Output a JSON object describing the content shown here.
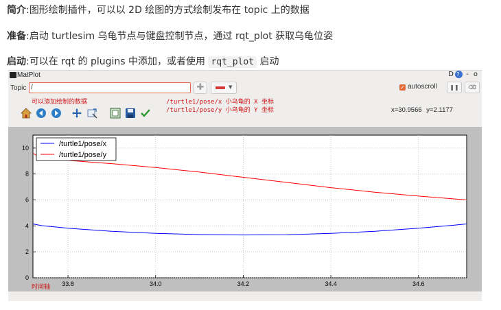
{
  "intro": {
    "line1_label": "简介",
    "line1_text": ":图形绘制插件，可以以 2D 绘图的方式绘制发布在 topic 上的数据",
    "line2_label": "准备",
    "line2_text": ":启动 turtlesim 乌龟节点与键盘控制节点，通过 rqt_plot 获取乌龟位姿",
    "line3_label": "启动",
    "line3_text_a": ":可以在 rqt 的 plugins 中添加，或者使用",
    "line3_code": "rqt_plot",
    "line3_text_b": "启动"
  },
  "window": {
    "title": "MatPlot",
    "controls": "D",
    "help": "?",
    "min": "-",
    "close": "o"
  },
  "topic": {
    "label": "Topic",
    "value": "/",
    "add_icon": "plus-icon",
    "remove_icon": "minus-icon"
  },
  "autoscroll": {
    "label": "autoscroll",
    "checked": true
  },
  "annotations": {
    "add_data": "可以添加绘制的数据",
    "pose_x": "/turtle1/pose/x 小乌龟的 X 坐标",
    "pose_y": "/turtle1/pose/y 小乌龟的 Y 坐标",
    "time_axis": "时间轴"
  },
  "cursor_readout": "x=30.9566   y=2.1177",
  "toolbar_icons": [
    "home-icon",
    "back-icon",
    "forward-icon",
    "pan-icon",
    "zoom-icon",
    "subplots-icon",
    "save-icon",
    "check-icon"
  ],
  "colors": {
    "series_x": "#0000ff",
    "series_y": "#ff0000",
    "topic_border": "#e06a4a",
    "annotation": "#d01515",
    "frame": "#bfbfbf"
  },
  "chart_data": {
    "type": "line",
    "xlim": [
      33.72,
      34.71
    ],
    "ylim": [
      0,
      11
    ],
    "xticks": [
      33.8,
      34.0,
      34.2,
      34.4,
      34.6
    ],
    "xtick_labels": [
      "33.8",
      "34.0",
      "34.2",
      "34.4",
      "34.6"
    ],
    "yticks": [
      0,
      2,
      4,
      6,
      8,
      10
    ],
    "ytick_labels": [
      "0",
      "2",
      "4",
      "6",
      "8",
      "10"
    ],
    "grid": true,
    "legend_position": "top-left",
    "series": [
      {
        "name": "/turtle1/pose/x",
        "color": "#0000ff",
        "x": [
          33.72,
          33.74,
          33.8,
          33.9,
          34.0,
          34.1,
          34.2,
          34.3,
          34.4,
          34.5,
          34.6,
          34.68,
          34.71
        ],
        "y": [
          4.15,
          4.02,
          3.82,
          3.58,
          3.42,
          3.33,
          3.3,
          3.32,
          3.42,
          3.58,
          3.82,
          4.05,
          4.15
        ]
      },
      {
        "name": "/turtle1/pose/y",
        "color": "#ff0000",
        "x": [
          33.72,
          33.74,
          33.8,
          33.9,
          34.0,
          34.1,
          34.2,
          34.3,
          34.4,
          34.5,
          34.6,
          34.71
        ],
        "y": [
          9.6,
          9.2,
          9.05,
          8.8,
          8.5,
          8.15,
          7.75,
          7.35,
          6.95,
          6.6,
          6.3,
          6.0
        ]
      }
    ]
  }
}
